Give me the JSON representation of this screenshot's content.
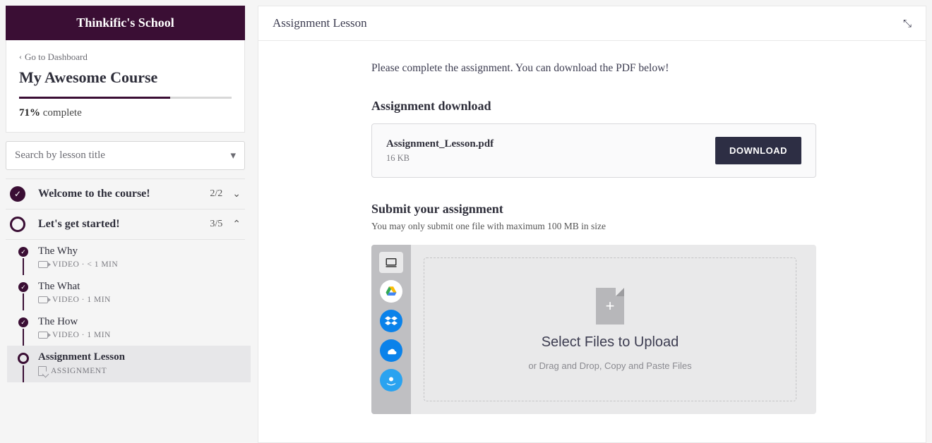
{
  "sidebar": {
    "school_name": "Thinkific's School",
    "dashboard_link": "Go to Dashboard",
    "course_title": "My Awesome Course",
    "progress_percent": "71%",
    "complete_label": "complete",
    "search_placeholder": "Search by lesson title"
  },
  "chapters": [
    {
      "title": "Welcome to the course!",
      "count": "2/2",
      "completed": true,
      "expanded": false
    },
    {
      "title": "Let's get started!",
      "count": "3/5",
      "completed": false,
      "expanded": true,
      "lessons": [
        {
          "title": "The Why",
          "meta": "VIDEO · < 1 MIN",
          "type": "video",
          "done": true
        },
        {
          "title": "The What",
          "meta": "VIDEO · 1 MIN",
          "type": "video",
          "done": true
        },
        {
          "title": "The How",
          "meta": "VIDEO · 1 MIN",
          "type": "video",
          "done": true
        },
        {
          "title": "Assignment Lesson",
          "meta": "ASSIGNMENT",
          "type": "assignment",
          "done": false,
          "active": true
        }
      ]
    }
  ],
  "main": {
    "title": "Assignment Lesson",
    "intro": "Please complete the assignment. You can download the PDF below!",
    "download_heading": "Assignment download",
    "file_name": "Assignment_Lesson.pdf",
    "file_size": "16 KB",
    "download_btn": "DOWNLOAD",
    "submit_heading": "Submit your assignment",
    "submit_hint": "You may only submit one file with maximum 100 MB in size",
    "upload_title": "Select Files to Upload",
    "upload_sub": "or Drag and Drop, Copy and Paste Files"
  }
}
